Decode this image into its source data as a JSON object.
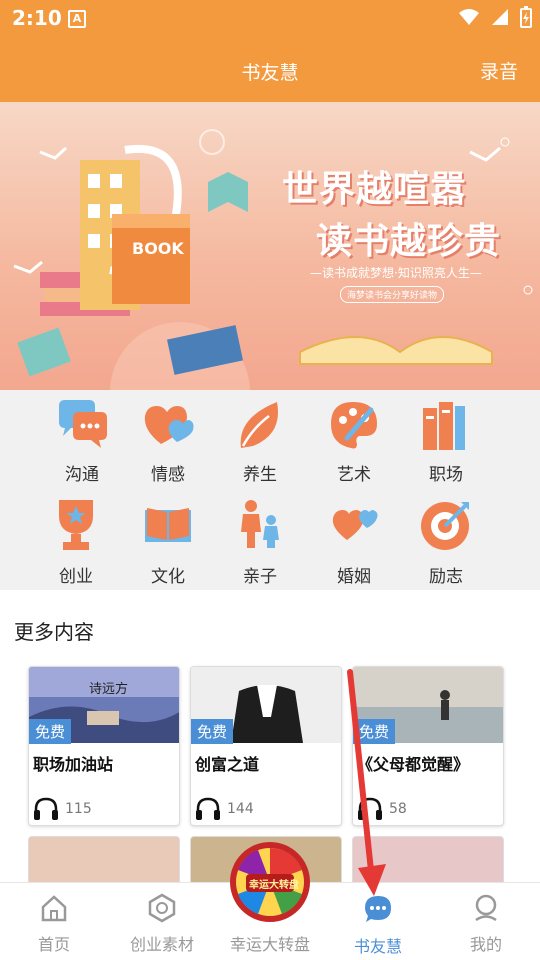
{
  "status": {
    "time": "2:10"
  },
  "header": {
    "title": "书友慧",
    "record_label": "录音"
  },
  "banner": {
    "headline1": "世界越喧嚣",
    "headline2": "读书越珍贵",
    "sub1": "—读书成就梦想·知识照亮人生—",
    "sub2": "海梦读书会分享好读物",
    "book_text": "BOOK"
  },
  "categories": [
    {
      "label": "沟通",
      "icon": "chat-bubbles-icon"
    },
    {
      "label": "情感",
      "icon": "hearts-icon"
    },
    {
      "label": "养生",
      "icon": "leaf-icon"
    },
    {
      "label": "艺术",
      "icon": "palette-icon"
    },
    {
      "label": "职场",
      "icon": "books-icon"
    },
    {
      "label": "创业",
      "icon": "trophy-icon"
    },
    {
      "label": "文化",
      "icon": "open-book-icon"
    },
    {
      "label": "亲子",
      "icon": "parent-child-icon"
    },
    {
      "label": "婚姻",
      "icon": "hearts-pair-icon"
    },
    {
      "label": "励志",
      "icon": "target-icon"
    }
  ],
  "more": {
    "title": "更多内容",
    "cards": [
      {
        "name": "职场加油站",
        "badge": "免费",
        "plays": "115",
        "thumb_text": "诗远方"
      },
      {
        "name": "创富之道",
        "badge": "免费",
        "plays": "144"
      },
      {
        "name": "《父母都觉醒》",
        "badge": "免费",
        "plays": "58"
      }
    ]
  },
  "nav": [
    {
      "label": "首页",
      "icon": "home-icon"
    },
    {
      "label": "创业素材",
      "icon": "hexagon-icon"
    },
    {
      "label": "幸运大转盘",
      "icon": "lucky-wheel-icon"
    },
    {
      "label": "书友慧",
      "icon": "chat-icon",
      "active": true
    },
    {
      "label": "我的",
      "icon": "user-icon"
    }
  ],
  "wheel_text": "幸运大转盘",
  "colors": {
    "header": "#F39A3F",
    "accent": "#4A8FD6",
    "icon_orange": "#F08050",
    "arrow": "#E53935"
  }
}
